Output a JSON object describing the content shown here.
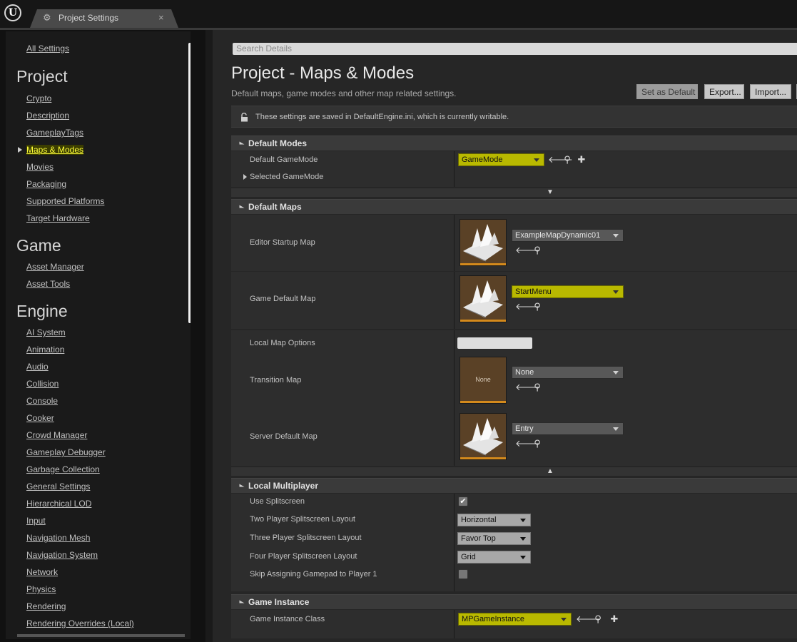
{
  "window": {
    "tab_title": "Project Settings",
    "tab_close": "×"
  },
  "sidebar": {
    "all_settings": "All Settings",
    "project_header": "Project",
    "project_items": [
      "Crypto",
      "Description",
      "GameplayTags",
      "Maps & Modes",
      "Movies",
      "Packaging",
      "Supported Platforms",
      "Target Hardware"
    ],
    "game_header": "Game",
    "game_items": [
      "Asset Manager",
      "Asset Tools"
    ],
    "engine_header": "Engine",
    "engine_items": [
      "AI System",
      "Animation",
      "Audio",
      "Collision",
      "Console",
      "Cooker",
      "Crowd Manager",
      "Gameplay Debugger",
      "Garbage Collection",
      "General Settings",
      "Hierarchical LOD",
      "Input",
      "Navigation Mesh",
      "Navigation System",
      "Network",
      "Physics",
      "Rendering",
      "Rendering Overrides (Local)"
    ],
    "selected": "Maps & Modes"
  },
  "main": {
    "search_placeholder": "Search Details",
    "title": "Project - Maps & Modes",
    "subtitle": "Default maps, game modes and other map related settings.",
    "buttons": {
      "set_default": "Set as Default",
      "export": "Export...",
      "import": "Import..."
    },
    "writable_msg": "These settings are saved in DefaultEngine.ini, which is currently writable."
  },
  "default_modes": {
    "title": "Default Modes",
    "default_gamemode_label": "Default GameMode",
    "default_gamemode_value": "GameMode",
    "selected_gamemode_label": "Selected GameMode"
  },
  "default_maps": {
    "title": "Default Maps",
    "editor_startup_label": "Editor Startup Map",
    "editor_startup_value": "ExampleMapDynamic01",
    "game_default_label": "Game Default Map",
    "game_default_value": "StartMenu",
    "local_map_options_label": "Local Map Options",
    "transition_label": "Transition Map",
    "transition_value": "None",
    "transition_thumb": "None",
    "server_default_label": "Server Default Map",
    "server_default_value": "Entry"
  },
  "local_multiplayer": {
    "title": "Local Multiplayer",
    "use_splitscreen_label": "Use Splitscreen",
    "use_splitscreen_checked": true,
    "two_player_label": "Two Player Splitscreen Layout",
    "two_player_value": "Horizontal",
    "three_player_label": "Three Player Splitscreen Layout",
    "three_player_value": "Favor Top",
    "four_player_label": "Four Player Splitscreen Layout",
    "four_player_value": "Grid",
    "skip_gamepad_label": "Skip Assigning Gamepad to Player 1",
    "skip_gamepad_checked": false
  },
  "game_instance": {
    "title": "Game Instance",
    "class_label": "Game Instance Class",
    "class_value": "MPGameInstance"
  },
  "colors": {
    "highlight": "#b9b900",
    "accent": "#d48a1c",
    "panel": "#2d2d2d"
  }
}
